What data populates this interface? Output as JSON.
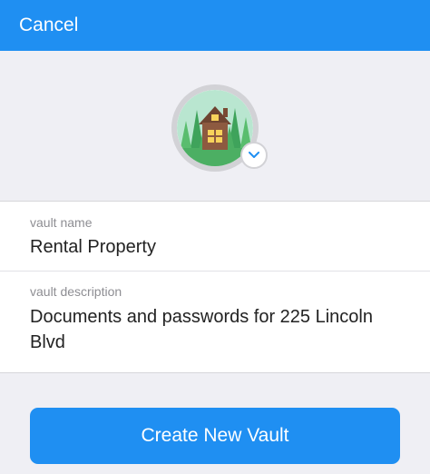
{
  "header": {
    "cancel_label": "Cancel",
    "background_color": "#1f8ff2"
  },
  "vault_icon": {
    "icon": "cabin-in-forest-icon",
    "dropdown_icon": "chevron-down-icon"
  },
  "form": {
    "name_label": "vault name",
    "name_value": "Rental Property",
    "description_label": "vault description",
    "description_value": "Documents and passwords for 225 Lincoln Blvd"
  },
  "actions": {
    "create_label": "Create New Vault",
    "accent_color": "#1f8ff2"
  }
}
